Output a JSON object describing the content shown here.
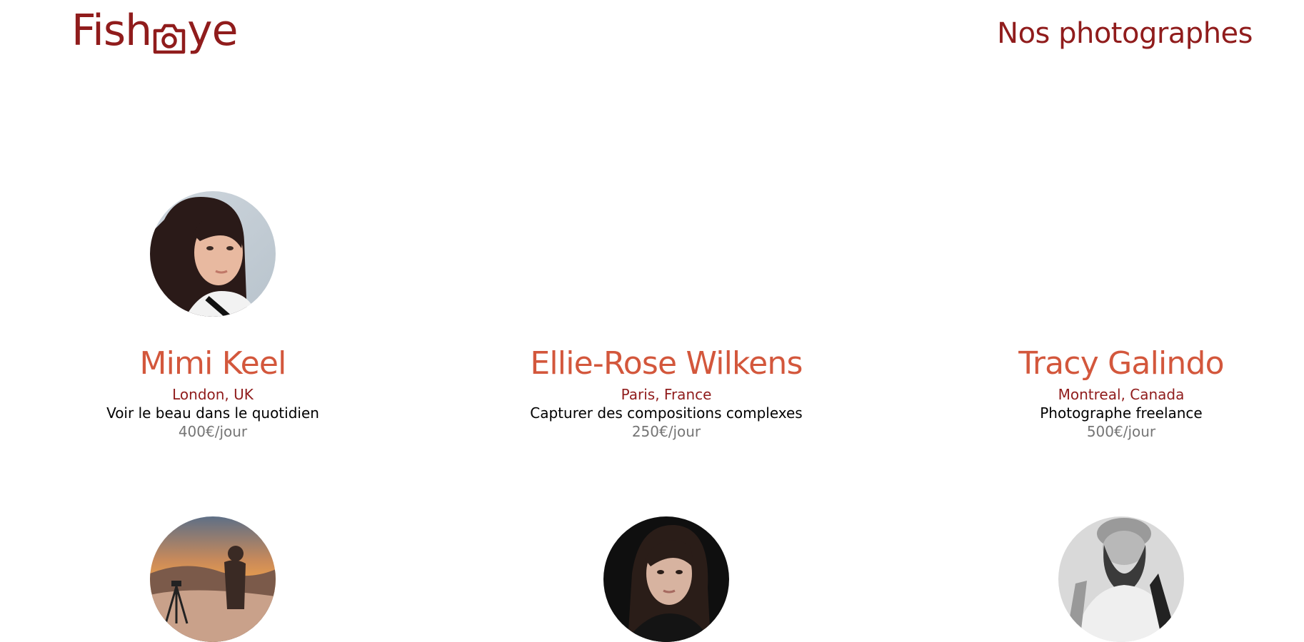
{
  "colors": {
    "brand": "#901c1c",
    "name": "#d3573c",
    "text": "#000000",
    "muted": "#757575",
    "background": "#ffffff"
  },
  "header": {
    "logo": {
      "left": "Fish",
      "icon": "camera-icon",
      "right": "ye"
    },
    "title": "Nos photographes"
  },
  "photographers": [
    {
      "name": "Mimi Keel",
      "location": "London, UK",
      "tagline": "Voir le beau dans le quotidien",
      "price": "400€/jour",
      "portrait": "woman-portrait"
    },
    {
      "name": "Ellie-Rose Wilkens",
      "location": "Paris, France",
      "tagline": "Capturer des compositions complexes",
      "price": "250€/jour",
      "portrait": "none"
    },
    {
      "name": "Tracy Galindo",
      "location": "Montreal, Canada",
      "tagline": "Photographe freelance",
      "price": "500€/jour",
      "portrait": "none"
    },
    {
      "portrait": "photographer-at-sunset"
    },
    {
      "portrait": "woman-dark-portrait"
    },
    {
      "portrait": "bearded-man-bw"
    }
  ]
}
